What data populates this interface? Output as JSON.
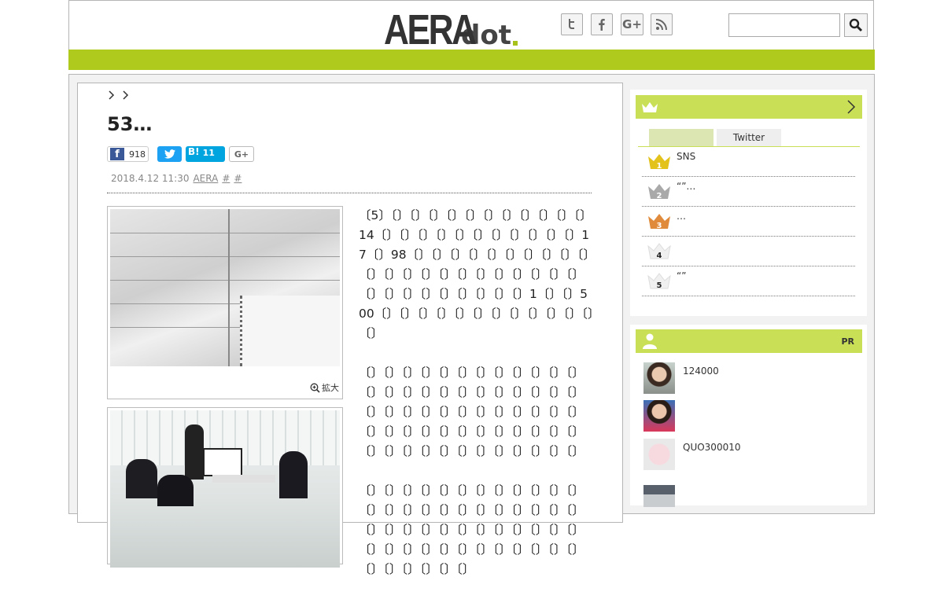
{
  "header": {
    "logo_main": "AERA",
    "logo_sub": "dot",
    "search_placeholder": ""
  },
  "icons": {
    "twitter": "twitter-icon",
    "facebook": "facebook-icon",
    "googleplus": "googleplus-icon",
    "rss": "rss-icon",
    "search": "search-icon"
  },
  "colors": {
    "accent": "#b0c91d",
    "sidebar_head": "#c9df55",
    "facebook": "#3b5998",
    "twitter": "#1da1f2",
    "hatena": "#00a4de"
  },
  "article": {
    "title": "53…",
    "share": {
      "facebook_count": "918",
      "hatena_label": "B!",
      "hatena_count": "11",
      "googleplus_label": "G+"
    },
    "meta": {
      "date": "2018.4.12 11:30",
      "source": "AERA",
      "tag1": "#",
      "tag2": "#"
    },
    "photo_zoom_label": "拡大",
    "paragraphs": [
      "〔5〕〔〕〔〕〔〕〔〕〔〕〔〕〔〕〔〕〔〕〔〕〔〕14〔〕〔〕〔〕〔〕〔〕〔〕〔〕〔〕〔〕〔〕〔〕17〔〕98〔〕〔〕〔〕〔〕〔〕〔〕〔〕〔〕〔〕〔〕〔〕〔〕〔〕〔〕〔〕〔〕〔〕〔〕〔〕〔〕〔〕〔〕〔〕〔〕〔〕〔〕〔〕〔〕〔〕〔〕〔〕1〔〕〔〕500〔〕〔〕〔〕〔〕〔〕〔〕〔〕〔〕〔〕〔〕〔〕〔〕〔〕",
      "〔〕〔〕〔〕〔〕〔〕〔〕〔〕〔〕〔〕〔〕〔〕〔〕〔〕〔〕〔〕〔〕〔〕〔〕〔〕〔〕〔〕〔〕〔〕〔〕〔〕〔〕〔〕〔〕〔〕〔〕〔〕〔〕〔〕〔〕〔〕〔〕〔〕〔〕〔〕〔〕〔〕〔〕〔〕〔〕〔〕〔〕〔〕〔〕〔〕〔〕〔〕〔〕〔〕〔〕〔〕〔〕〔〕〔〕〔〕〔〕",
      "〔〕〔〕〔〕〔〕〔〕〔〕〔〕〔〕〔〕〔〕〔〕〔〕〔〕〔〕〔〕〔〕〔〕〔〕〔〕〔〕〔〕〔〕〔〕〔〕〔〕〔〕〔〕〔〕〔〕〔〕〔〕〔〕〔〕〔〕〔〕〔〕〔〕〔〕〔〕〔〕〔〕〔〕〔〕〔〕〔〕〔〕〔〕〔〕〔〕〔〕〔〕〔〕〔〕〔〕"
    ]
  },
  "ranking": {
    "tab_active": "",
    "tab_twitter": "Twitter",
    "items": [
      {
        "rank": "1",
        "text": "SNS"
      },
      {
        "rank": "2",
        "text": "“”…"
      },
      {
        "rank": "3",
        "text": "…"
      },
      {
        "rank": "4",
        "text": ""
      },
      {
        "rank": "5",
        "text": "“”"
      }
    ]
  },
  "pr": {
    "label": "PR",
    "items": [
      {
        "text": "124000"
      },
      {
        "text": ""
      },
      {
        "text": "QUO300010"
      },
      {
        "text": ""
      }
    ]
  }
}
